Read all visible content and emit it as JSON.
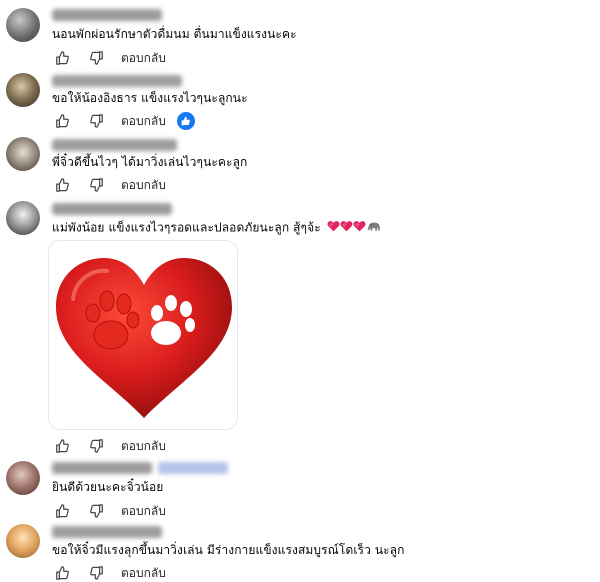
{
  "reply_label": "ตอบกลับ",
  "comments": [
    {
      "text": "นอนพักผ่อนรักษาตัวดื่มนม ตื่นมาแข็งแรงนะคะ"
    },
    {
      "text": "ขอให้น้องอิงธาร แข็งแรงไวๆนะลูกนะ",
      "reaction": "like"
    },
    {
      "text": "พี่จิ๋วดีขึ้นไวๆ ได้มาวิ่งเล่นไวๆนะคะลูก"
    },
    {
      "text": "แม่พังน้อย แข็งแรงไวๆรอดและปลอดภัยนะลูก สู้ๆจ้ะ",
      "emojis": [
        "heart-icon",
        "heart-icon",
        "heart-icon",
        "elephant-icon"
      ],
      "sticker": "heart-paw-sticker"
    },
    {
      "text": "ยินดีด้วยนะคะจิ๋วน้อย"
    },
    {
      "text": "ขอให้จิ๋วมีแรงลุกขึ้นมาวิ่งเล่น มีร่างกายแข็งแรงสมบูรณ์โดเร็ว นะลูก"
    }
  ],
  "colors": {
    "reaction": "#1877f2",
    "sticker_heart": "#d81c1c",
    "action_icon": "#444444"
  }
}
